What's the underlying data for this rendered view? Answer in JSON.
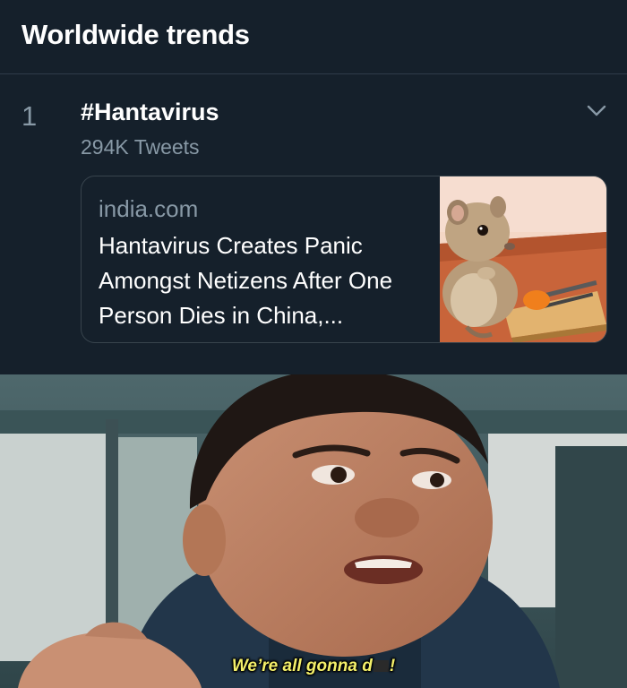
{
  "header": {
    "title": "Worldwide trends"
  },
  "trend": {
    "rank": "1",
    "name": "#Hantavirus",
    "tweet_count": "294K Tweets",
    "card": {
      "source": "india.com",
      "headline": "Hantavirus Creates Panic Amongst Netizens After One Person Dies in China,..."
    }
  },
  "meme": {
    "caption_before": "We’re all gonna d",
    "caption_after": "!"
  },
  "colors": {
    "background": "#15202b",
    "text_primary": "#ffffff",
    "text_secondary": "#8899a6",
    "border": "#38444d",
    "caption": "#f3ef6a"
  },
  "icons": {
    "trend_menu": "chevron-down-icon"
  }
}
